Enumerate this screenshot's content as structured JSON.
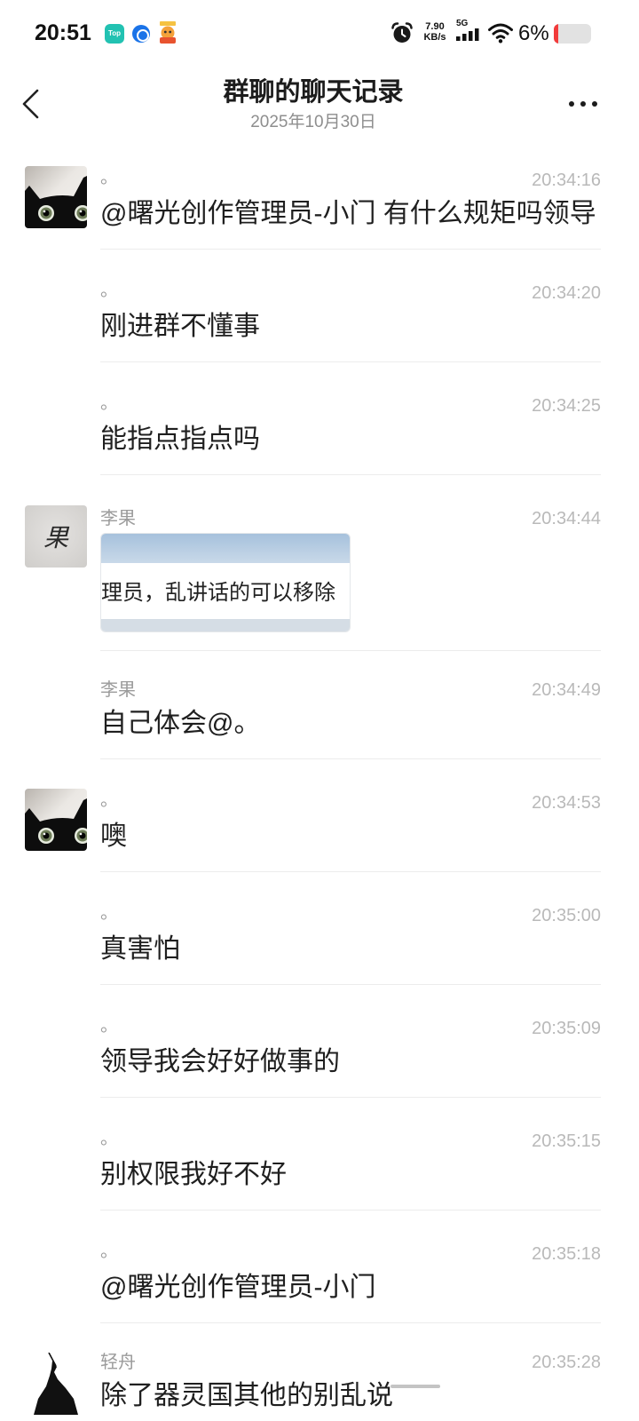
{
  "status_bar": {
    "time": "20:51",
    "app_icons": [
      {
        "icon": "top-app-icon",
        "label": "Top"
      },
      {
        "icon": "blue-circle-app-icon"
      },
      {
        "icon": "cartoon-app-icon"
      }
    ],
    "alarm_icon": "alarm-icon",
    "net_speed_value": "7.90",
    "net_speed_unit": "KB/s",
    "network_type": "5G",
    "signal_icon": "signal-bars-icon",
    "wifi_icon": "wifi-icon",
    "battery_percent": "6%",
    "battery_level": 6
  },
  "header": {
    "back_icon": "chevron-left-icon",
    "title": "群聊的聊天记录",
    "subtitle": "2025年10月30日",
    "more_icon": "more-horizontal-icon"
  },
  "messages": [
    {
      "sender": "。",
      "time": "20:34:16",
      "text": "@曙光创作管理员-小门 有什么规矩吗领导",
      "avatar": "black-cat"
    },
    {
      "sender": "。",
      "time": "20:34:20",
      "text": "刚进群不懂事"
    },
    {
      "sender": "。",
      "time": "20:34:25",
      "text": "能指点指点吗"
    },
    {
      "sender": "李果",
      "time": "20:34:44",
      "avatar": "handwritten-character",
      "avatar_text": "果",
      "image": {
        "text": "理员，乱讲话的可以移除"
      }
    },
    {
      "sender": "李果",
      "time": "20:34:49",
      "text": "自己体会@。"
    },
    {
      "sender": "。",
      "time": "20:34:53",
      "text": "噢",
      "avatar": "black-cat"
    },
    {
      "sender": "。",
      "time": "20:35:00",
      "text": "真害怕"
    },
    {
      "sender": "。",
      "time": "20:35:09",
      "text": "领导我会好好做事的"
    },
    {
      "sender": "。",
      "time": "20:35:15",
      "text": "别权限我好不好"
    },
    {
      "sender": "。",
      "time": "20:35:18",
      "text": "@曙光创作管理员-小门"
    },
    {
      "sender": "轻舟",
      "time": "20:35:28",
      "text": "除了器灵国其他的别乱说",
      "avatar": "ink-figure"
    }
  ],
  "colors": {
    "background": "#ffffff",
    "message_text": "#1f1f1f",
    "timestamp": "#b9b9b9",
    "sender_name": "#9b9b9b",
    "battery_low": "#f23b3b",
    "top_app_icon": "#22c2b2",
    "blue_app_icon": "#1a73e8"
  }
}
